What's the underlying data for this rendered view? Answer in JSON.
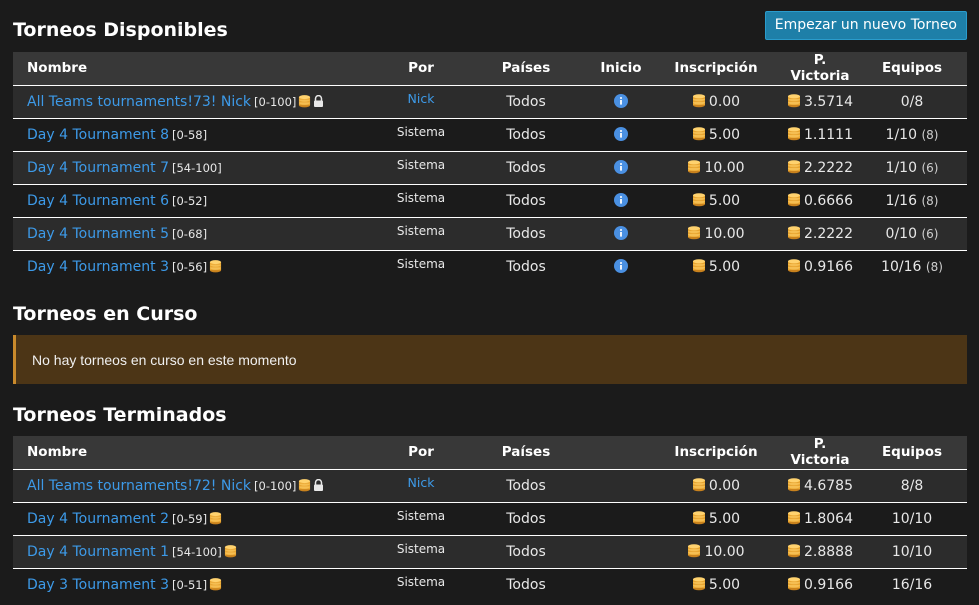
{
  "colors": {
    "background": "#1b1b1b",
    "header_row": "#383838",
    "link": "#3d9ae8",
    "button": "#1e7fa8",
    "coin": "#e8a531",
    "alert_bg": "#4c3516",
    "alert_border": "#c98a2c",
    "info": "#4a90e2"
  },
  "available": {
    "title": "Torneos Disponibles",
    "new_button": "Empezar un nuevo Torneo",
    "headers": {
      "name": "Nombre",
      "by": "Por",
      "countries": "Países",
      "start": "Inicio",
      "fee": "Inscripción",
      "win": "P. Victoria",
      "teams": "Equipos"
    },
    "rows": [
      {
        "name": "All Teams tournaments!73! Nick",
        "range": "[0-100]",
        "coin_icon": "coins-icon",
        "lock_icon": "lock-icon",
        "by": "Nick",
        "countries": "Todos",
        "start_icon": "info-icon",
        "fee": "0.00",
        "win": "3.5714",
        "teams": "0/8",
        "teams_extra": ""
      },
      {
        "name": "Day 4 Tournament 8",
        "range": "[0-58]",
        "coin_icon": "",
        "lock_icon": "",
        "by": "Sistema",
        "countries": "Todos",
        "start_icon": "info-icon",
        "fee": "5.00",
        "win": "1.1111",
        "teams": "1/10",
        "teams_extra": "(8)"
      },
      {
        "name": "Day 4 Tournament 7",
        "range": "[54-100]",
        "coin_icon": "",
        "lock_icon": "",
        "by": "Sistema",
        "countries": "Todos",
        "start_icon": "info-icon",
        "fee": "10.00",
        "win": "2.2222",
        "teams": "1/10",
        "teams_extra": "(6)"
      },
      {
        "name": "Day 4 Tournament 6",
        "range": "[0-52]",
        "coin_icon": "",
        "lock_icon": "",
        "by": "Sistema",
        "countries": "Todos",
        "start_icon": "info-icon",
        "fee": "5.00",
        "win": "0.6666",
        "teams": "1/16",
        "teams_extra": "(8)"
      },
      {
        "name": "Day 4 Tournament 5",
        "range": "[0-68]",
        "coin_icon": "",
        "lock_icon": "",
        "by": "Sistema",
        "countries": "Todos",
        "start_icon": "info-icon",
        "fee": "10.00",
        "win": "2.2222",
        "teams": "0/10",
        "teams_extra": "(6)"
      },
      {
        "name": "Day 4 Tournament 3",
        "range": "[0-56]",
        "coin_icon": "coins-icon",
        "lock_icon": "",
        "by": "Sistema",
        "countries": "Todos",
        "start_icon": "info-icon",
        "fee": "5.00",
        "win": "0.9166",
        "teams": "10/16",
        "teams_extra": "(8)"
      }
    ]
  },
  "in_progress": {
    "title": "Torneos en Curso",
    "message": "No hay torneos en curso en este momento"
  },
  "finished": {
    "title": "Torneos Terminados",
    "headers": {
      "name": "Nombre",
      "by": "Por",
      "countries": "Países",
      "start": "",
      "fee": "Inscripción",
      "win": "P. Victoria",
      "teams": "Equipos"
    },
    "rows": [
      {
        "name": "All Teams tournaments!72! Nick",
        "range": "[0-100]",
        "coin_icon": "coins-icon",
        "lock_icon": "lock-icon",
        "by": "Nick",
        "countries": "Todos",
        "fee": "0.00",
        "win": "4.6785",
        "teams": "8/8"
      },
      {
        "name": "Day 4 Tournament 2",
        "range": "[0-59]",
        "coin_icon": "coins-icon",
        "lock_icon": "",
        "by": "Sistema",
        "countries": "Todos",
        "fee": "5.00",
        "win": "1.8064",
        "teams": "10/10"
      },
      {
        "name": "Day 4 Tournament 1",
        "range": "[54-100]",
        "coin_icon": "coins-icon",
        "lock_icon": "",
        "by": "Sistema",
        "countries": "Todos",
        "fee": "10.00",
        "win": "2.8888",
        "teams": "10/10"
      },
      {
        "name": "Day 3 Tournament 3",
        "range": "[0-51]",
        "coin_icon": "coins-icon",
        "lock_icon": "",
        "by": "Sistema",
        "countries": "Todos",
        "fee": "5.00",
        "win": "0.9166",
        "teams": "16/16"
      }
    ]
  }
}
